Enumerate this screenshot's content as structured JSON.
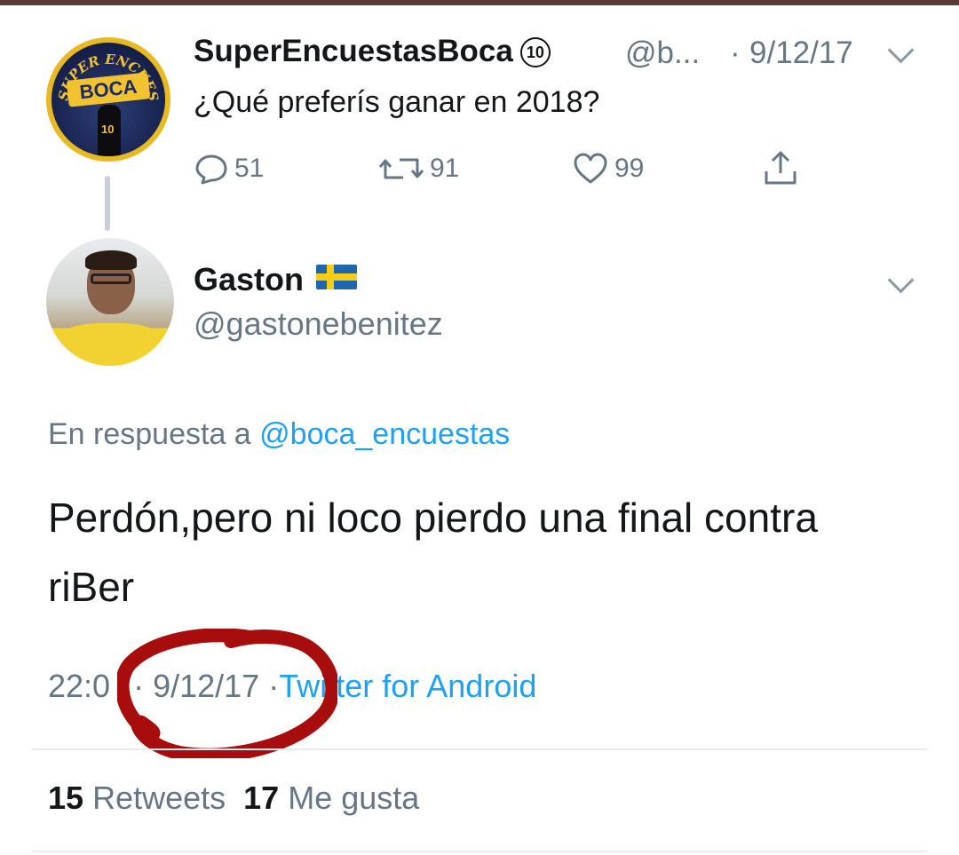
{
  "window": {
    "top_bar_color": "#5a3b3b"
  },
  "parent_tweet": {
    "avatar": {
      "icon": "boca-encuestas-logo",
      "logo_text": "BOCA",
      "arc_text": "SUPER ENCUESTAS",
      "jersey_number": "10"
    },
    "display_name": "SuperEncuestasBoca",
    "name_badge": "10",
    "handle": "@b...",
    "separator": "·",
    "date": "9/12/17",
    "text": "¿Qué preferís ganar en 2018?",
    "actions": {
      "reply_count": "51",
      "retweet_count": "91",
      "like_count": "99"
    }
  },
  "reply_tweet": {
    "avatar": {
      "icon": "user-photo"
    },
    "display_name": "Gaston",
    "flag": "sweden-flag",
    "handle": "@gastonebenitez",
    "replying_to_label": "En respuesta a",
    "replying_to_handle": "@boca_encuestas",
    "text": "Perdón,pero ni loco pierdo una final contra riBer",
    "time": "22:0",
    "separator": "·",
    "date": "9/12/17",
    "source": "Twitter for Android",
    "retweets_count": "15",
    "retweets_label": "Retweets",
    "likes_count": "17",
    "likes_label": "Me gusta"
  },
  "colors": {
    "text_primary": "#14171a",
    "text_secondary": "#657786",
    "link": "#1da1f2",
    "annotation_circle": "#a80d0d"
  }
}
